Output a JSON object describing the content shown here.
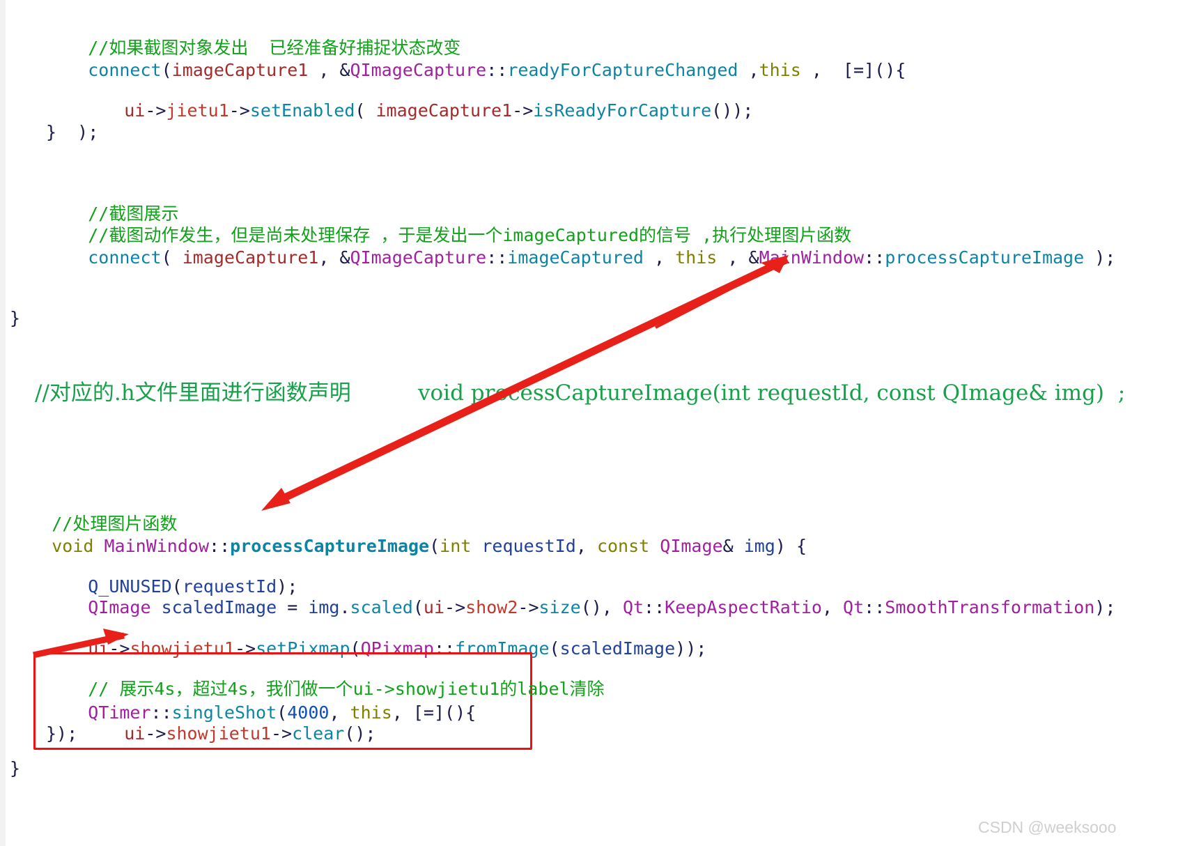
{
  "document": {
    "kind": "source-code-screenshot",
    "language": "C++ / Qt",
    "watermark": "CSDN @weeksooo"
  },
  "colors": {
    "comment_green": "#11a11a",
    "function_teal": "#0e84a5",
    "class_purple": "#a020a0",
    "member_red": "#a52a2a",
    "keyword_olive": "#808000",
    "number_blue": "#0b4fbe",
    "annotation_red": "#ee1111",
    "declaration_green": "#18a04a",
    "watermark_grey": "#cfcfcf",
    "page_background": "#ffffff"
  },
  "code_top": {
    "l1_comment": "//如果截图对象发出  已经准备好捕捉状态改变",
    "l2": {
      "connect": "connect",
      "paren_open": "(",
      "arg1": "imageCapture1",
      "sep1": " , &",
      "class": "QImageCapture",
      "scope": "::",
      "signal": "readyForCaptureChanged",
      "sep2": " ,",
      "this": "this",
      "sep3": " ,  [=](){"
    },
    "l3": {
      "ui": "ui",
      "arrow1": "->",
      "widget": "jietu1",
      "arrow2": "->",
      "method": "setEnabled",
      "open": "( ",
      "obj": "imageCapture1",
      "arrow3": "->",
      "call": "isReadyForCapture",
      "close": "());"
    },
    "l4": "}  );",
    "l5_comment": "//截图展示",
    "l6_comment_a": "//截图动作发生，但是尚未处理保存 ，于是发出一个",
    "l6_code": "imageCaptured",
    "l6_comment_b": "的信号 ,执行处理图片函数",
    "l7": {
      "connect": "connect",
      "open": "( ",
      "arg1": "imageCapture1",
      "sep1": ", &",
      "class": "QImageCapture",
      "scope1": "::",
      "signal": "imageCaptured",
      "sep2": " , ",
      "this": "this",
      "sep3": " , &",
      "class2": "MainWindow",
      "scope2": "::",
      "slot": "processCaptureImage",
      "close": " );"
    },
    "l8_brace": "}"
  },
  "declaration_line": {
    "comment": "//对应的.h文件里面进行函数声明",
    "declaration": "void processCaptureImage(int requestId, const QImage& img)  ;"
  },
  "code_bottom": {
    "l1_comment": "//处理图片函数",
    "l2": {
      "void": "void",
      "space": " ",
      "class": "MainWindow",
      "scope": "::",
      "func": "processCaptureImage",
      "open": "(",
      "int": "int",
      "p1": " requestId",
      "comma": ", ",
      "const": "const",
      "p2": " ",
      "qimage": "QImage",
      "amp": "&",
      "p3": " img",
      "close": ") {"
    },
    "l3": {
      "macro": "Q_UNUSED",
      "open": "(",
      "arg": "requestId",
      "close": ");"
    },
    "l4": {
      "type": "QImage",
      "var": " scaledImage",
      "eq": " = ",
      "img": "img",
      "dot": ".",
      "method": "scaled",
      "open": "(",
      "ui": "ui",
      "arrow1": "->",
      "widget": "show2",
      "arrow2": "->",
      "size": "size",
      "mid": "(), ",
      "qt1": "Qt",
      "scope1": "::",
      "enum1": "KeepAspectRatio",
      "comma": ", ",
      "qt2": "Qt",
      "scope2": "::",
      "enum2": "SmoothTransformation",
      "close": ");"
    },
    "l5": {
      "ui": "ui",
      "arrow1": "->",
      "widget": "showjietu1",
      "arrow2": "->",
      "method": "setPixmap",
      "open": "(",
      "class": "QPixmap",
      "scope": "::",
      "fn": "fromImage",
      "open2": "(",
      "arg": "scaledImage",
      "close": "));"
    },
    "boxed": {
      "comment": "// 展示4s，超过4s，我们做一个ui->showjietu1的label清除",
      "timer_line": {
        "class": "QTimer",
        "scope": "::",
        "method": "singleShot",
        "open": "(",
        "num": "4000",
        "comma": ", ",
        "this": "this",
        "rest": ", [=](){"
      },
      "clear_line": {
        "ui": "ui",
        "arrow1": "->",
        "widget": "showjietu1",
        "arrow2": "->",
        "method": "clear",
        "close": "();"
      },
      "close_line": "});"
    },
    "final_brace": "}"
  },
  "annotations": {
    "arrow_long_label": "long-red-arrow-from-process-capture-image-definition-to-connect-slot",
    "arrow_short_label": "short-red-arrow-pointing-to-red-box"
  }
}
